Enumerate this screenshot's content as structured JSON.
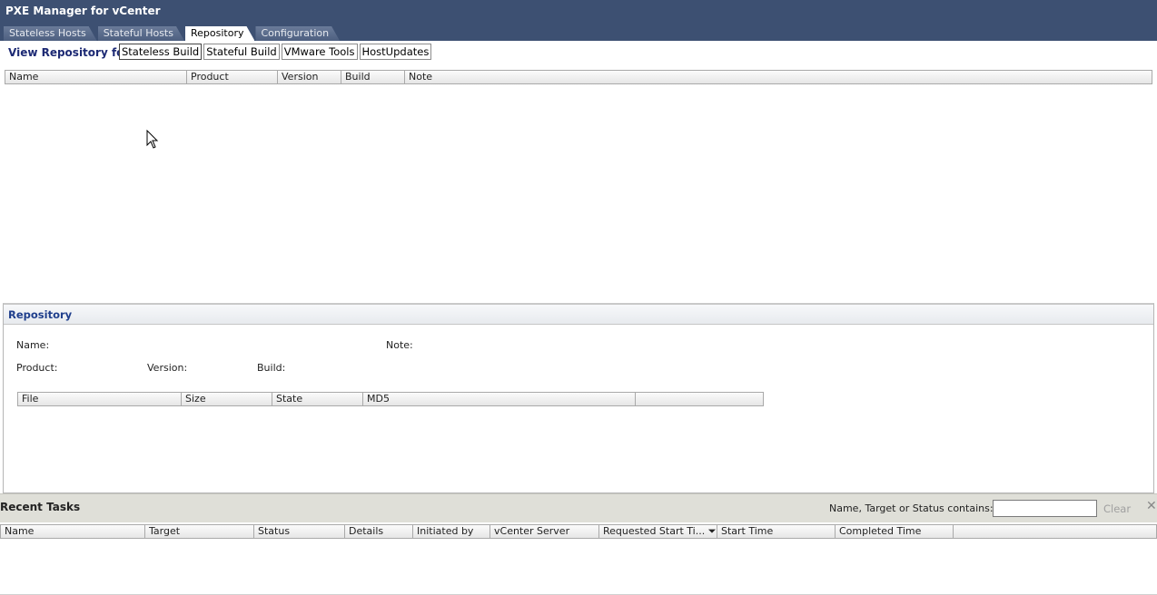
{
  "app": {
    "title": "PXE Manager for vCenter",
    "tabs": [
      {
        "label": "Stateless Hosts",
        "active": false
      },
      {
        "label": "Stateful Hosts",
        "active": false
      },
      {
        "label": "Repository",
        "active": true
      },
      {
        "label": "Configuration",
        "active": false
      }
    ]
  },
  "view": {
    "label": "View Repository for :",
    "buttons": [
      {
        "label": "Stateless Build",
        "active": true
      },
      {
        "label": "Stateful Build",
        "active": false
      },
      {
        "label": "VMware Tools",
        "active": false
      },
      {
        "label": "HostUpdates",
        "active": false
      }
    ]
  },
  "repo_grid": {
    "columns": [
      "Name",
      "Product",
      "Version",
      "Build",
      "Note"
    ],
    "rows": []
  },
  "detail": {
    "title": "Repository",
    "name_label": "Name:",
    "note_label": "Note:",
    "product_label": "Product:",
    "version_label": "Version:",
    "build_label": "Build:",
    "file_columns": [
      "File",
      "Size",
      "State",
      "MD5",
      ""
    ]
  },
  "tasks": {
    "title": "Recent Tasks",
    "filter_label": "Name, Target or Status contains: ▾",
    "filter_value": "",
    "clear_label": "Clear",
    "close_glyph": "✕",
    "columns": [
      "Name",
      "Target",
      "Status",
      "Details",
      "Initiated by",
      "vCenter Server",
      "Requested Start Ti... ⏷",
      "Start Time",
      "Completed Time"
    ],
    "rows": []
  }
}
